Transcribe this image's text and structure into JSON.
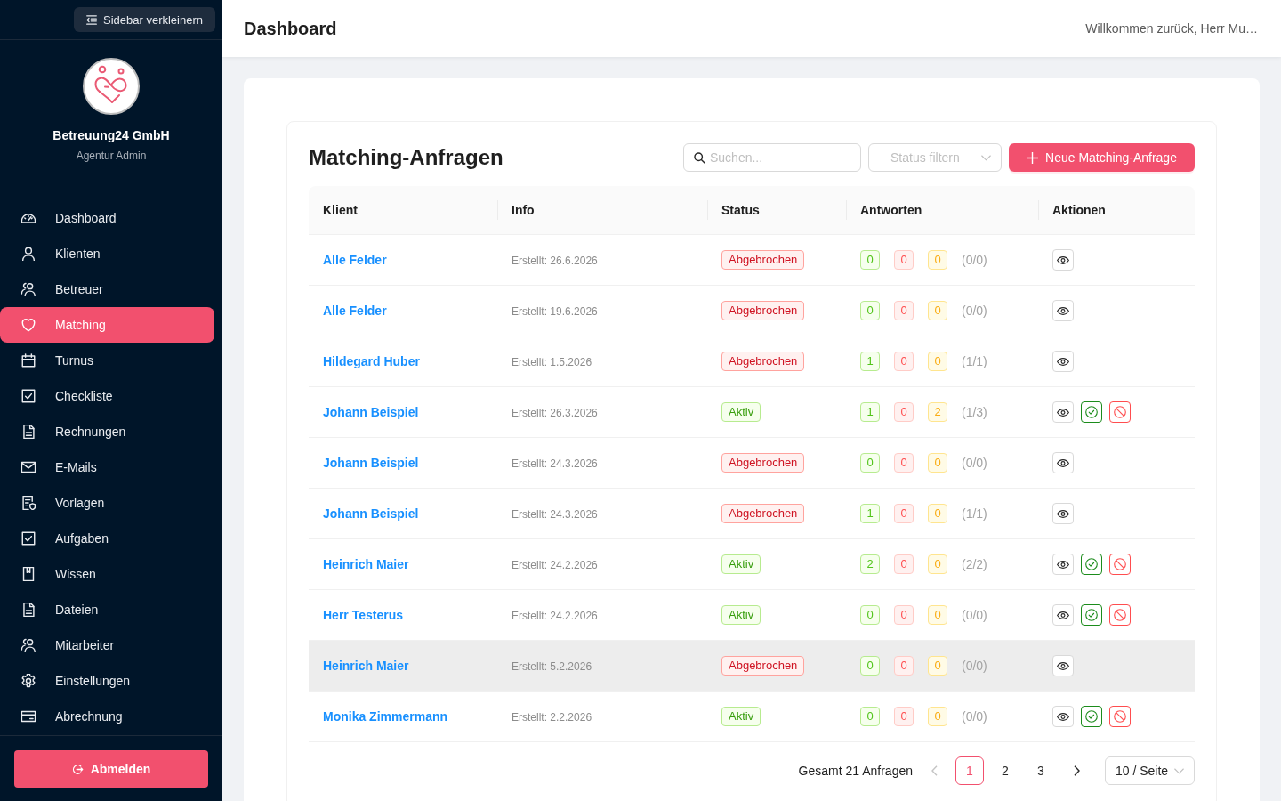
{
  "sidebar": {
    "collapse_button": "Sidebar verkleinern",
    "company": "Betreuung24 GmbH",
    "role": "Agentur Admin",
    "items": [
      {
        "label": "Dashboard",
        "kind": "dashboard",
        "selected": false
      },
      {
        "label": "Klienten",
        "kind": "user",
        "selected": false
      },
      {
        "label": "Betreuer",
        "kind": "team",
        "selected": false
      },
      {
        "label": "Matching",
        "kind": "heart",
        "selected": true
      },
      {
        "label": "Turnus",
        "kind": "calendar",
        "selected": false
      },
      {
        "label": "Checkliste",
        "kind": "checkbox",
        "selected": false
      },
      {
        "label": "Rechnungen",
        "kind": "document",
        "selected": false
      },
      {
        "label": "E-Mails",
        "kind": "mail",
        "selected": false
      },
      {
        "label": "Vorlagen",
        "kind": "template",
        "selected": false
      },
      {
        "label": "Aufgaben",
        "kind": "checkbox",
        "selected": false
      },
      {
        "label": "Wissen",
        "kind": "book",
        "selected": false
      },
      {
        "label": "Dateien",
        "kind": "document",
        "selected": false
      },
      {
        "label": "Mitarbeiter",
        "kind": "team",
        "selected": false
      },
      {
        "label": "Einstellungen",
        "kind": "settings",
        "selected": false
      },
      {
        "label": "Abrechnung",
        "kind": "card",
        "selected": false
      }
    ],
    "logout_button": "Abmelden"
  },
  "header": {
    "title": "Dashboard",
    "welcome": "Willkommen zurück, Herr Mu…"
  },
  "panel": {
    "title": "Matching-Anfragen",
    "search": {
      "placeholder": "Suchen..."
    },
    "status_filter": {
      "placeholder": "Status filtern"
    },
    "new_button": "Neue Matching-Anfrage",
    "table": {
      "columns": [
        "Klient",
        "Info",
        "Status",
        "Antworten",
        "Aktionen"
      ],
      "rows": [
        {
          "client": "Alle Felder",
          "info": "Erstellt: 26.6.2026",
          "status": {
            "label": "Abgebrochen",
            "kind": "cancelled"
          },
          "answers": [
            {
              "kind": "accepted",
              "count": "0"
            },
            {
              "kind": "rejected",
              "count": "0"
            },
            {
              "kind": "pending",
              "count": "0"
            }
          ],
          "ratio": "(0/0)",
          "actions": [
            {
              "kind": "view"
            }
          ],
          "highlighted": false
        },
        {
          "client": "Alle Felder",
          "info": "Erstellt: 19.6.2026",
          "status": {
            "label": "Abgebrochen",
            "kind": "cancelled"
          },
          "answers": [
            {
              "kind": "accepted",
              "count": "0"
            },
            {
              "kind": "rejected",
              "count": "0"
            },
            {
              "kind": "pending",
              "count": "0"
            }
          ],
          "ratio": "(0/0)",
          "actions": [
            {
              "kind": "view"
            }
          ],
          "highlighted": false
        },
        {
          "client": "Hildegard Huber",
          "info": "Erstellt: 1.5.2026",
          "status": {
            "label": "Abgebrochen",
            "kind": "cancelled"
          },
          "answers": [
            {
              "kind": "accepted",
              "count": "1"
            },
            {
              "kind": "rejected",
              "count": "0"
            },
            {
              "kind": "pending",
              "count": "0"
            }
          ],
          "ratio": "(1/1)",
          "actions": [
            {
              "kind": "view"
            }
          ],
          "highlighted": false
        },
        {
          "client": "Johann Beispiel",
          "info": "Erstellt: 26.3.2026",
          "status": {
            "label": "Aktiv",
            "kind": "active"
          },
          "answers": [
            {
              "kind": "accepted",
              "count": "1"
            },
            {
              "kind": "rejected",
              "count": "0"
            },
            {
              "kind": "pending",
              "count": "2"
            }
          ],
          "ratio": "(1/3)",
          "actions": [
            {
              "kind": "view"
            },
            {
              "kind": "approve"
            },
            {
              "kind": "cancel"
            }
          ],
          "highlighted": false
        },
        {
          "client": "Johann Beispiel",
          "info": "Erstellt: 24.3.2026",
          "status": {
            "label": "Abgebrochen",
            "kind": "cancelled"
          },
          "answers": [
            {
              "kind": "accepted",
              "count": "0"
            },
            {
              "kind": "rejected",
              "count": "0"
            },
            {
              "kind": "pending",
              "count": "0"
            }
          ],
          "ratio": "(0/0)",
          "actions": [
            {
              "kind": "view"
            }
          ],
          "highlighted": false
        },
        {
          "client": "Johann Beispiel",
          "info": "Erstellt: 24.3.2026",
          "status": {
            "label": "Abgebrochen",
            "kind": "cancelled"
          },
          "answers": [
            {
              "kind": "accepted",
              "count": "1"
            },
            {
              "kind": "rejected",
              "count": "0"
            },
            {
              "kind": "pending",
              "count": "0"
            }
          ],
          "ratio": "(1/1)",
          "actions": [
            {
              "kind": "view"
            }
          ],
          "highlighted": false
        },
        {
          "client": "Heinrich Maier",
          "info": "Erstellt: 24.2.2026",
          "status": {
            "label": "Aktiv",
            "kind": "active"
          },
          "answers": [
            {
              "kind": "accepted",
              "count": "2"
            },
            {
              "kind": "rejected",
              "count": "0"
            },
            {
              "kind": "pending",
              "count": "0"
            }
          ],
          "ratio": "(2/2)",
          "actions": [
            {
              "kind": "view"
            },
            {
              "kind": "approve"
            },
            {
              "kind": "cancel"
            }
          ],
          "highlighted": false
        },
        {
          "client": "Herr Testerus",
          "info": "Erstellt: 24.2.2026",
          "status": {
            "label": "Aktiv",
            "kind": "active"
          },
          "answers": [
            {
              "kind": "accepted",
              "count": "0"
            },
            {
              "kind": "rejected",
              "count": "0"
            },
            {
              "kind": "pending",
              "count": "0"
            }
          ],
          "ratio": "(0/0)",
          "actions": [
            {
              "kind": "view"
            },
            {
              "kind": "approve"
            },
            {
              "kind": "cancel"
            }
          ],
          "highlighted": false
        },
        {
          "client": "Heinrich Maier",
          "info": "Erstellt: 5.2.2026",
          "status": {
            "label": "Abgebrochen",
            "kind": "cancelled"
          },
          "answers": [
            {
              "kind": "accepted",
              "count": "0"
            },
            {
              "kind": "rejected",
              "count": "0"
            },
            {
              "kind": "pending",
              "count": "0"
            }
          ],
          "ratio": "(0/0)",
          "actions": [
            {
              "kind": "view"
            }
          ],
          "highlighted": true
        },
        {
          "client": "Monika Zimmermann",
          "info": "Erstellt: 2.2.2026",
          "status": {
            "label": "Aktiv",
            "kind": "active"
          },
          "answers": [
            {
              "kind": "accepted",
              "count": "0"
            },
            {
              "kind": "rejected",
              "count": "0"
            },
            {
              "kind": "pending",
              "count": "0"
            }
          ],
          "ratio": "(0/0)",
          "actions": [
            {
              "kind": "view"
            },
            {
              "kind": "approve"
            },
            {
              "kind": "cancel"
            }
          ],
          "highlighted": false
        }
      ]
    },
    "pagination": {
      "total": "Gesamt 21 Anfragen",
      "prev": {
        "disabled": true
      },
      "pages": [
        {
          "label": "1",
          "selected": true
        },
        {
          "label": "2",
          "selected": false
        },
        {
          "label": "3",
          "selected": false
        }
      ],
      "next": {
        "disabled": false
      },
      "page_size": "10 / Seite"
    }
  }
}
